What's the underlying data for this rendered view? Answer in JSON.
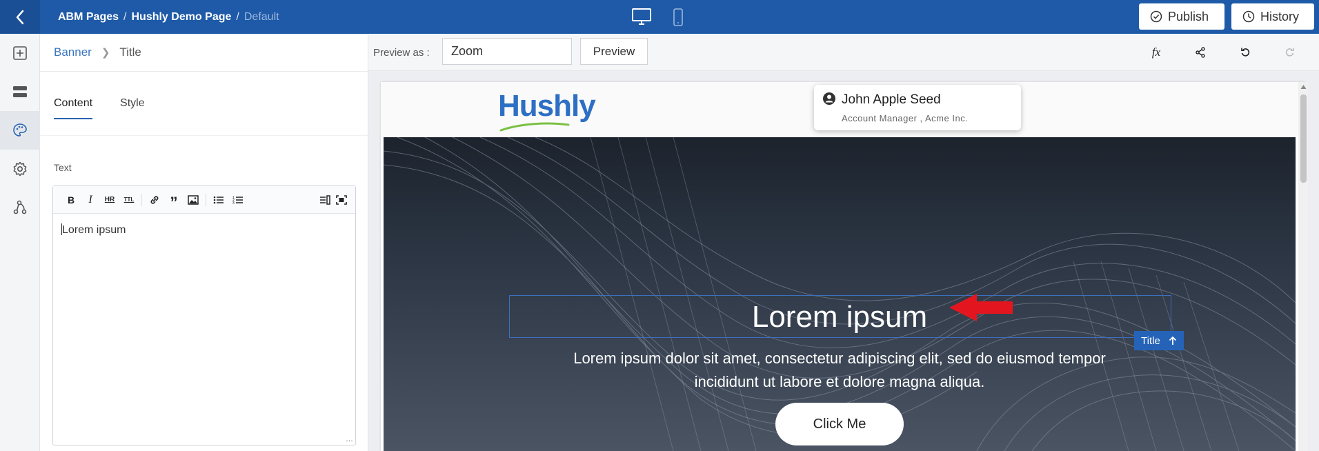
{
  "topbar": {
    "breadcrumb": [
      "ABM Pages",
      "Hushly Demo Page",
      "Default"
    ],
    "publish_label": "Publish",
    "history_label": "History",
    "device_modes": [
      "desktop",
      "mobile"
    ]
  },
  "rail": {
    "items": [
      "add-block-icon",
      "layers-icon",
      "palette-icon",
      "settings-icon",
      "flow-icon"
    ],
    "active": "palette-icon"
  },
  "panel": {
    "breadcrumb_parent": "Banner",
    "breadcrumb_current": "Title",
    "tabs": [
      {
        "label": "Content",
        "active": true
      },
      {
        "label": "Style",
        "active": false
      }
    ],
    "field_label": "Text",
    "editor_value": "Lorem ipsum",
    "toolbar": {
      "bold": "B",
      "italic": "I",
      "hr": "HR",
      "ttl": "TTL"
    }
  },
  "preview_toolbar": {
    "label": "Preview as :",
    "input_value": "Zoom",
    "preview_button": "Preview",
    "fx_label": "fx"
  },
  "site": {
    "logo_text": "Hushly",
    "user_name": "John Apple Seed",
    "user_role": "Account Manager , Acme Inc.",
    "badge_label": "Title",
    "banner_title": "Lorem ipsum",
    "banner_line1": "Lorem ipsum dolor sit amet, consectetur adipiscing elit, sed do eiusmod tempor",
    "banner_line2": "incididunt ut labore et dolore magna aliqua.",
    "cta_label": "Click Me"
  },
  "colors": {
    "brand_blue": "#1e5aa8",
    "accent_blue": "#2563b8",
    "annotation_red": "#e3161f"
  }
}
